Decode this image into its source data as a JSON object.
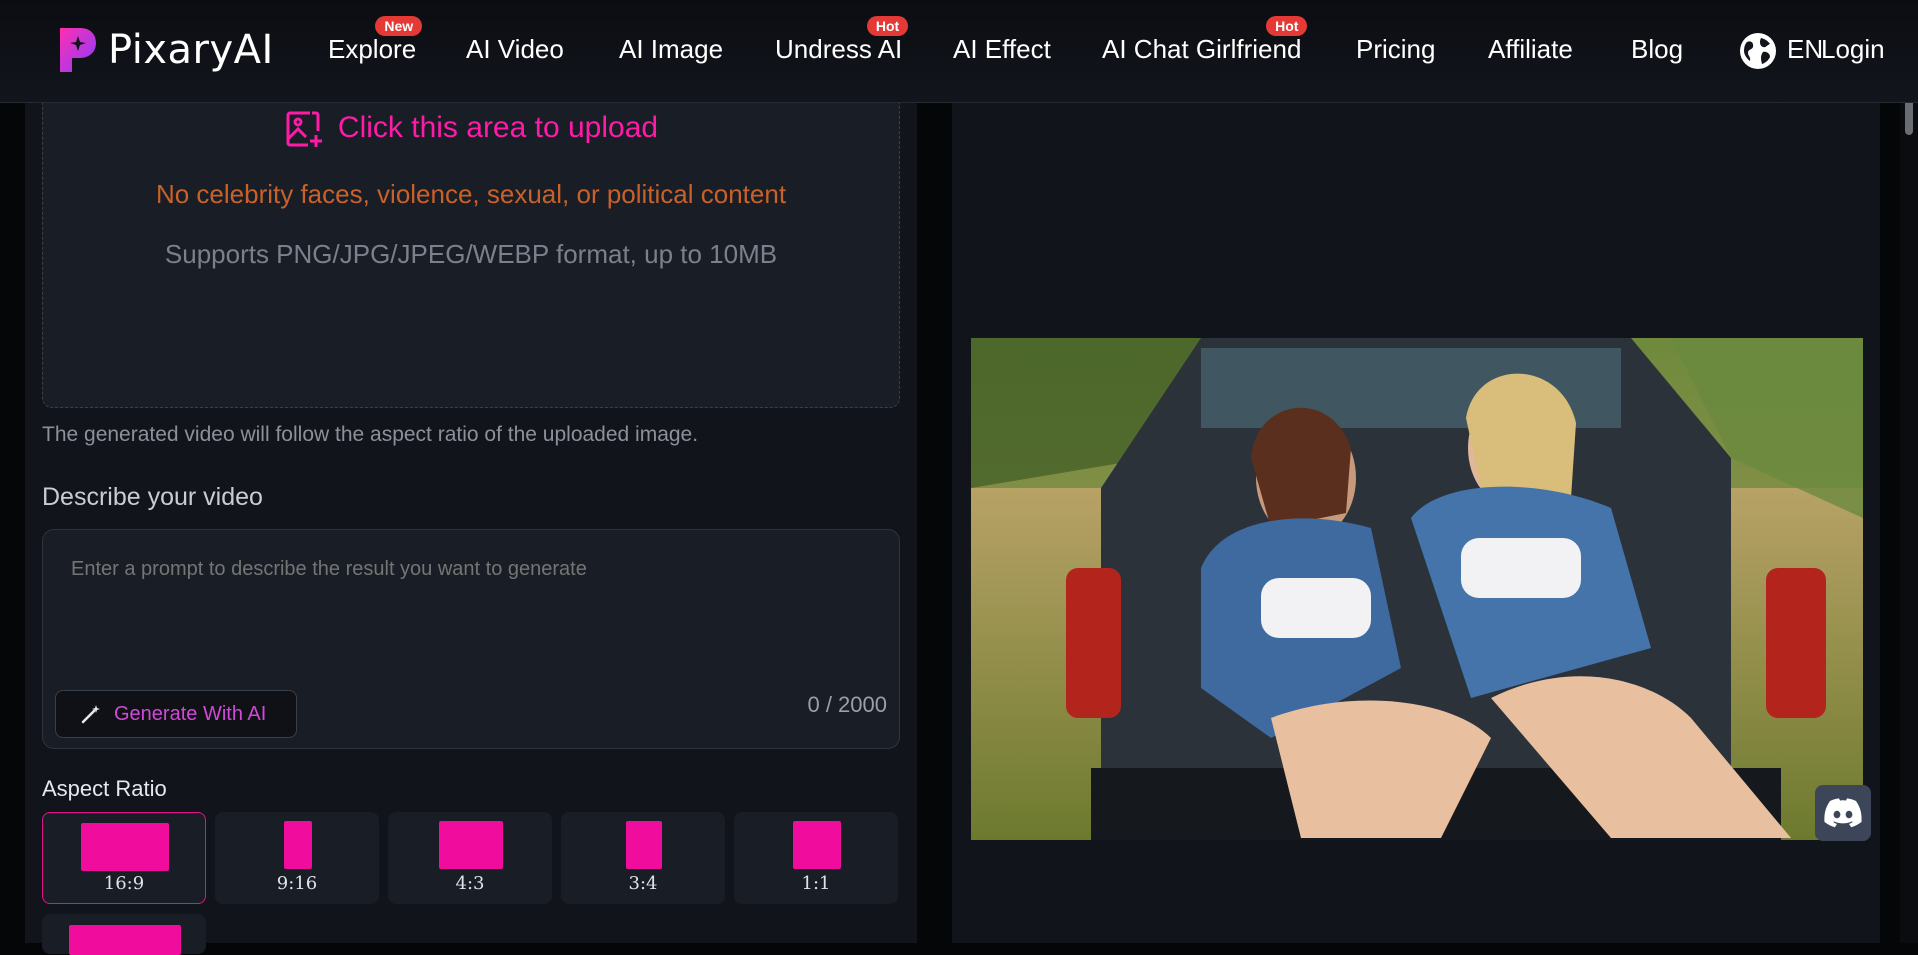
{
  "brand": {
    "name": "PixaryAI"
  },
  "nav": {
    "items": [
      {
        "label": "Explore",
        "badge": "New"
      },
      {
        "label": "AI Video",
        "badge": ""
      },
      {
        "label": "AI Image",
        "badge": ""
      },
      {
        "label": "Undress AI",
        "badge": "Hot"
      },
      {
        "label": "AI Effect",
        "badge": ""
      },
      {
        "label": "AI Chat Girlfriend",
        "badge": "Hot"
      },
      {
        "label": "Pricing",
        "badge": ""
      },
      {
        "label": "Affiliate",
        "badge": ""
      },
      {
        "label": "Blog",
        "badge": ""
      }
    ],
    "language": "EN",
    "login": "Login"
  },
  "upload": {
    "title": "Click this area to upload",
    "warning": "No celebrity faces, violence, sexual, or political content",
    "supports": "Supports PNG/JPG/JPEG/WEBP format, up to 10MB"
  },
  "hint": "The generated video will follow the aspect ratio of the uploaded image.",
  "prompt": {
    "title": "Describe your video",
    "placeholder": "Enter a prompt to describe the result you want to generate",
    "generate_label": "Generate With AI",
    "counter": "0 / 2000"
  },
  "aspect": {
    "title": "Aspect Ratio",
    "options": [
      "16:9",
      "9:16",
      "4:3",
      "3:4",
      "1:1"
    ],
    "selected": "16:9"
  },
  "colors": {
    "accent": "#f00c9c",
    "warning": "#c8612a",
    "badge": "#e53935"
  }
}
